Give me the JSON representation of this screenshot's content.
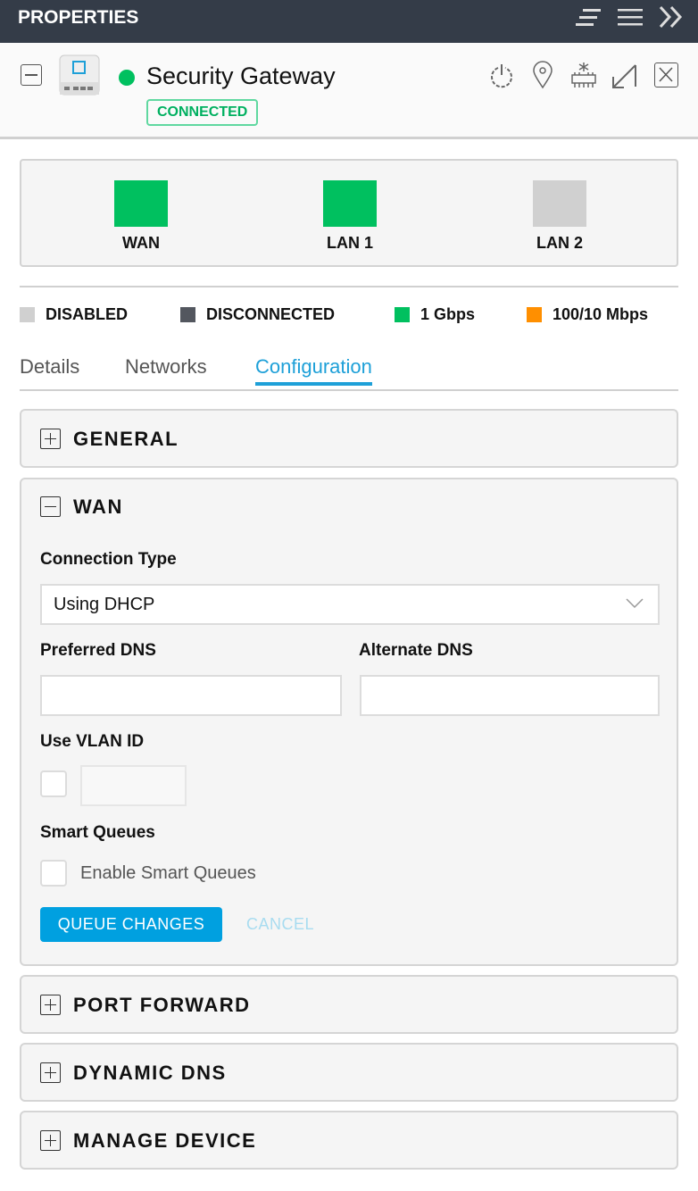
{
  "header": {
    "title": "PROPERTIES",
    "icons": [
      "sort-icon",
      "menu-icon",
      "collapse-icon"
    ]
  },
  "device": {
    "name": "Security Gateway",
    "status": "CONNECTED",
    "status_color": "#00c05f",
    "actions": [
      "restart-icon",
      "locate-icon",
      "upgrade-icon",
      "expand-icon",
      "close-icon"
    ]
  },
  "ports": [
    {
      "label": "WAN",
      "color": "#00c05f"
    },
    {
      "label": "LAN 1",
      "color": "#00c05f"
    },
    {
      "label": "LAN 2",
      "color": "#d0d0d0"
    }
  ],
  "legend": [
    {
      "label": "DISABLED",
      "color": "#d0d0d0"
    },
    {
      "label": "DISCONNECTED",
      "color": "#53575f"
    },
    {
      "label": "1 Gbps",
      "color": "#00c05f"
    },
    {
      "label": "100/10 Mbps",
      "color": "#ff8f00"
    }
  ],
  "tabs": [
    {
      "label": "Details"
    },
    {
      "label": "Networks"
    },
    {
      "label": "Configuration",
      "active": true
    }
  ],
  "accent": "#00a0e0",
  "sections": {
    "general": "GENERAL",
    "wan": {
      "title": "WAN",
      "connection_type_label": "Connection Type",
      "connection_type_value": "Using DHCP",
      "preferred_dns_label": "Preferred DNS",
      "preferred_dns_value": "",
      "alternate_dns_label": "Alternate DNS",
      "alternate_dns_value": "",
      "vlan_label": "Use VLAN ID",
      "vlan_checked": false,
      "vlan_value": "",
      "smart_queues_label": "Smart Queues",
      "smart_queues_option": "Enable Smart Queues",
      "smart_queues_checked": false,
      "queue_button": "QUEUE CHANGES",
      "cancel_button": "CANCEL"
    },
    "port_forward": "PORT FORWARD",
    "dynamic_dns": "DYNAMIC DNS",
    "manage_device": "MANAGE DEVICE"
  }
}
